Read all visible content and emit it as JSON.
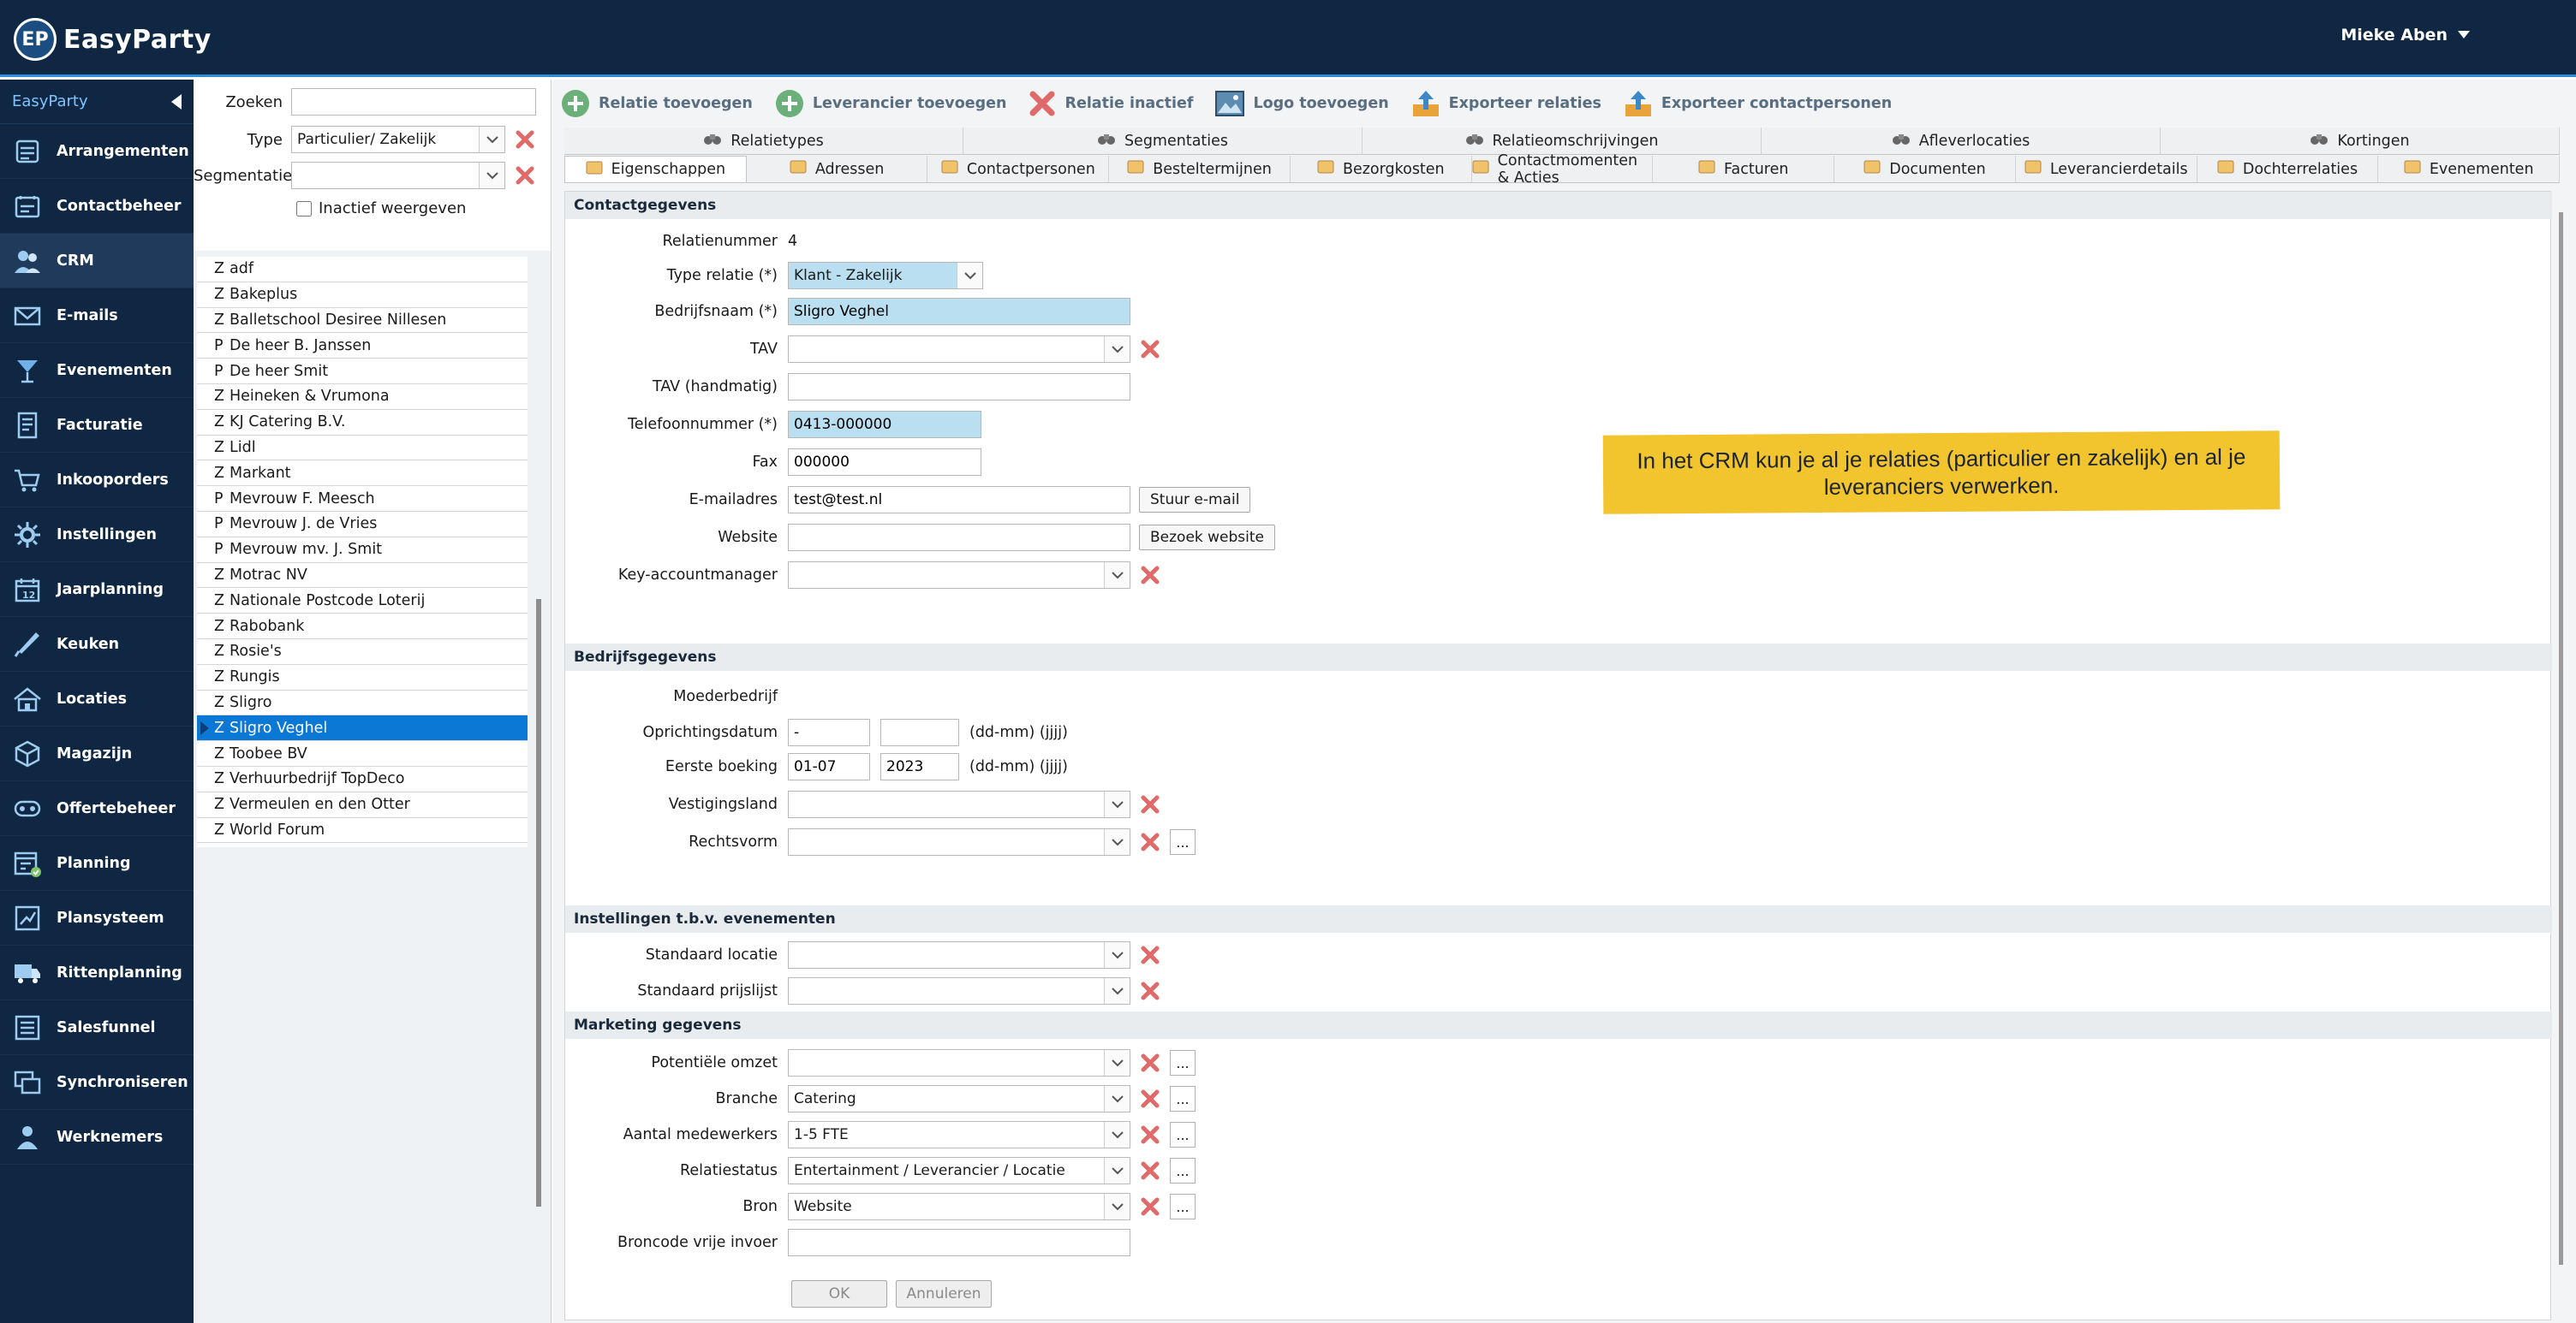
{
  "app": {
    "logo_badge": "EP",
    "name": "EasyParty",
    "user": "Mieke Aben"
  },
  "sidebar": {
    "header": "EasyParty",
    "items": [
      {
        "label": "Arrangementen",
        "icon": "arrangement-icon"
      },
      {
        "label": "Contactbeheer",
        "icon": "contact-icon"
      },
      {
        "label": "CRM",
        "icon": "crm-icon"
      },
      {
        "label": "E-mails",
        "icon": "mail-icon"
      },
      {
        "label": "Evenementen",
        "icon": "cocktail-icon"
      },
      {
        "label": "Facturatie",
        "icon": "invoice-icon"
      },
      {
        "label": "Inkooporders",
        "icon": "cart-icon"
      },
      {
        "label": "Instellingen",
        "icon": "gear-icon"
      },
      {
        "label": "Jaarplanning",
        "icon": "calendar-icon"
      },
      {
        "label": "Keuken",
        "icon": "knife-icon"
      },
      {
        "label": "Locaties",
        "icon": "building-icon"
      },
      {
        "label": "Magazijn",
        "icon": "box-icon"
      },
      {
        "label": "Offertebeheer",
        "icon": "quote-icon"
      },
      {
        "label": "Planning",
        "icon": "planning-icon"
      },
      {
        "label": "Plansysteem",
        "icon": "plansystem-icon"
      },
      {
        "label": "Rittenplanning",
        "icon": "truck-icon"
      },
      {
        "label": "Salesfunnel",
        "icon": "funnel-icon"
      },
      {
        "label": "Synchroniseren",
        "icon": "sync-icon"
      },
      {
        "label": "Werknemers",
        "icon": "employees-icon"
      }
    ]
  },
  "search": {
    "zoeken_label": "Zoeken",
    "zoeken_value": "",
    "type_label": "Type",
    "type_value": "Particulier/ Zakelijk",
    "segmentatie_label": "Segmentatie",
    "segmentatie_value": "",
    "inactief_label": "Inactief weergeven"
  },
  "relations": [
    {
      "t": "Z",
      "name": "adf"
    },
    {
      "t": "Z",
      "name": "Bakeplus"
    },
    {
      "t": "Z",
      "name": "Balletschool Desiree Nillesen"
    },
    {
      "t": "P",
      "name": "De heer B. Janssen"
    },
    {
      "t": "P",
      "name": "De heer Smit"
    },
    {
      "t": "Z",
      "name": "Heineken & Vrumona"
    },
    {
      "t": "Z",
      "name": "KJ Catering B.V."
    },
    {
      "t": "Z",
      "name": "Lidl"
    },
    {
      "t": "Z",
      "name": "Markant"
    },
    {
      "t": "P",
      "name": "Mevrouw F. Meesch"
    },
    {
      "t": "P",
      "name": "Mevrouw J. de Vries"
    },
    {
      "t": "P",
      "name": "Mevrouw mv. J. Smit"
    },
    {
      "t": "Z",
      "name": "Motrac NV"
    },
    {
      "t": "Z",
      "name": "Nationale Postcode Loterij"
    },
    {
      "t": "Z",
      "name": "Rabobank"
    },
    {
      "t": "Z",
      "name": "Rosie's"
    },
    {
      "t": "Z",
      "name": "Rungis"
    },
    {
      "t": "Z",
      "name": "Sligro"
    },
    {
      "t": "Z",
      "name": "Sligro Veghel",
      "selected": true
    },
    {
      "t": "Z",
      "name": "Toobee BV"
    },
    {
      "t": "Z",
      "name": "Verhuurbedrijf TopDeco"
    },
    {
      "t": "Z",
      "name": "Vermeulen en den Otter"
    },
    {
      "t": "Z",
      "name": "World Forum"
    }
  ],
  "toolbar": {
    "relatie_toevoegen": "Relatie toevoegen",
    "leverancier_toevoegen": "Leverancier toevoegen",
    "relatie_inactief": "Relatie inactief",
    "logo_toevoegen": "Logo toevoegen",
    "exporteer_relaties": "Exporteer relaties",
    "exporteer_contactpersonen": "Exporteer contactpersonen"
  },
  "tabs_row1": [
    "Relatietypes",
    "Segmentaties",
    "Relatieomschrijvingen",
    "Afleverlocaties",
    "Kortingen"
  ],
  "tabs_row2": [
    "Eigenschappen",
    "Adressen",
    "Contactpersonen",
    "Besteltermijnen",
    "Bezorgkosten",
    "Contactmomenten & Acties",
    "Facturen",
    "Documenten",
    "Leverancierdetails",
    "Dochterrelaties",
    "Evenementen"
  ],
  "sections": {
    "contact": "Contactgegevens",
    "bedrijf": "Bedrijfsgegevens",
    "instellingen": "Instellingen t.b.v. evenementen",
    "marketing": "Marketing gegevens"
  },
  "contact": {
    "relatienummer_label": "Relatienummer",
    "relatienummer": "4",
    "type_label": "Type relatie (*)",
    "type": "Klant - Zakelijk",
    "bedrijfsnaam_label": "Bedrijfsnaam (*)",
    "bedrijfsnaam": "Sligro Veghel",
    "tav_label": "TAV",
    "tav": "",
    "tav_hand_label": "TAV (handmatig)",
    "tav_hand": "",
    "telefoon_label": "Telefoonnummer (*)",
    "telefoon": "0413-000000",
    "fax_label": "Fax",
    "fax": "000000",
    "email_label": "E-mailadres",
    "email": "test@test.nl",
    "email_btn": "Stuur e-mail",
    "website_label": "Website",
    "website": "",
    "website_btn": "Bezoek website",
    "kam_label": "Key-accountmanager",
    "kam": ""
  },
  "bedrijf": {
    "moeder_label": "Moederbedrijf",
    "opr_label": "Oprichtingsdatum",
    "opr_dm": "-",
    "opr_j": "",
    "fmt": "(dd-mm) (jjjj)",
    "eerste_label": "Eerste boeking",
    "eerste_dm": "01-07",
    "eerste_j": "2023",
    "land_label": "Vestigingsland",
    "land": "",
    "rechtsvorm_label": "Rechtsvorm",
    "rechtsvorm": ""
  },
  "instellingen": {
    "locatie_label": "Standaard locatie",
    "locatie": "",
    "prijslijst_label": "Standaard prijslijst",
    "prijslijst": ""
  },
  "marketing": {
    "omzet_label": "Potentiële omzet",
    "omzet": "",
    "branche_label": "Branche",
    "branche": "Catering",
    "medewerkers_label": "Aantal medewerkers",
    "medewerkers": "1-5 FTE",
    "status_label": "Relatiestatus",
    "status": "Entertainment / Leverancier / Locatie",
    "bron_label": "Bron",
    "bron": "Website",
    "broncode_label": "Broncode vrije invoer",
    "broncode": ""
  },
  "buttons": {
    "ok": "OK",
    "annuleren": "Annuleren",
    "dots": "..."
  },
  "note": "In het CRM kun je al je relaties (particulier en zakelijk) en al je leveranciers verwerken.",
  "colors": {
    "nav_bg": "#0f2742",
    "accent": "#0b78d6",
    "note_bg": "#f2c42e",
    "delete_red": "#e06a6a"
  }
}
